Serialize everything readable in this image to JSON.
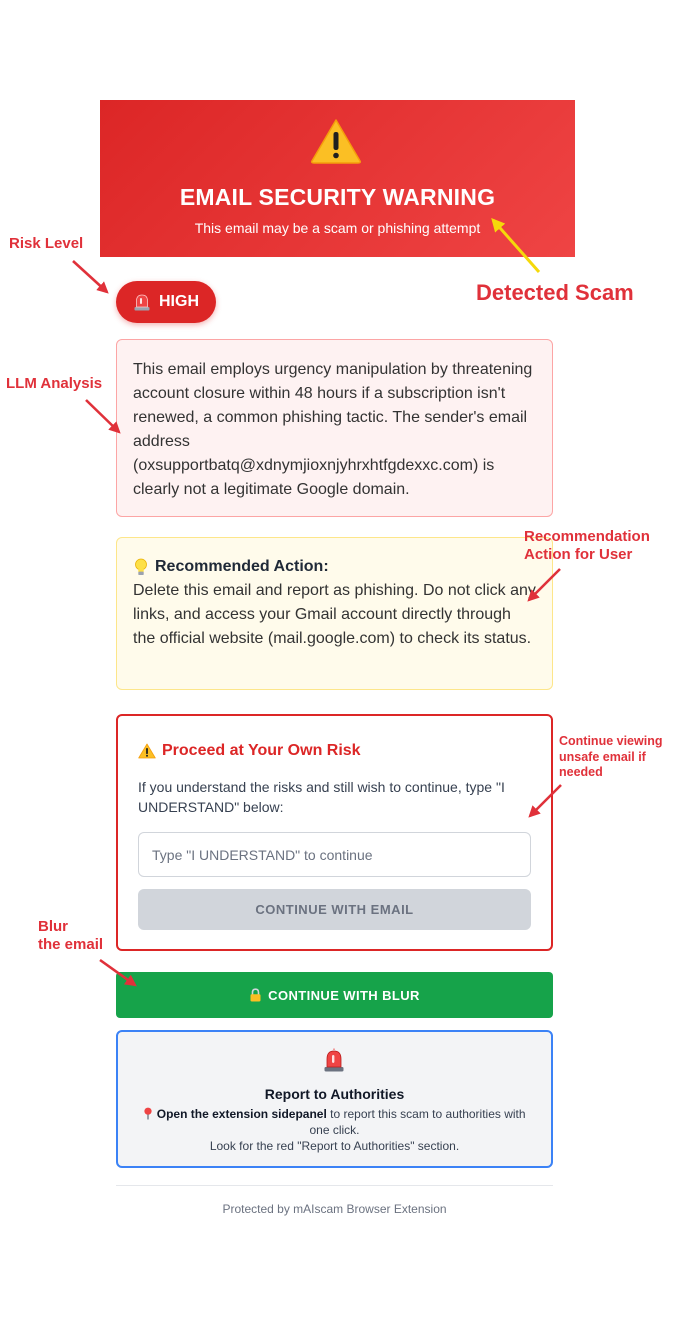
{
  "banner": {
    "title": "EMAIL SECURITY WARNING",
    "subtitle": "This email may be a scam or phishing attempt",
    "icon": "warning-triangle-icon"
  },
  "risk": {
    "label": "HIGH",
    "icon": "siren-icon"
  },
  "analysis": {
    "text": "This email employs urgency manipulation by threatening account closure within 48 hours if a subscription isn't renewed, a common phishing tactic. The sender's email address (oxsupportbatq@xdnymjioxnjyhrxhtfgdexxc.com) is clearly not a legitimate Google domain."
  },
  "recommendation": {
    "heading": "Recommended Action:",
    "icon": "lightbulb-icon",
    "text": "Delete this email and report as phishing. Do not click any links, and access your Gmail account directly through the official website (mail.google.com) to check its status."
  },
  "proceed": {
    "title": "Proceed at Your Own Risk",
    "text": "If you understand the risks and still wish to continue, type \"I UNDERSTAND\" below:",
    "input_placeholder": "Type \"I UNDERSTAND\" to continue",
    "input_value": "",
    "button_label": "CONTINUE WITH EMAIL"
  },
  "blur_button": {
    "label": "CONTINUE WITH BLUR",
    "icon": "lock-icon"
  },
  "report": {
    "title": "Report to Authorities",
    "link_text": "Open the extension sidepanel",
    "text_rest": " to report this scam to authorities with one click.",
    "line2": "Look for the red \"Report to Authorities\" section."
  },
  "footer": {
    "text": "Protected by mAIscam Browser Extension"
  },
  "annotations": {
    "risk_level": "Risk Level",
    "llm_analysis": "LLM Analysis",
    "detected_scam": "Detected Scam",
    "recommendation_line1": "Recommendation",
    "recommendation_line2": "Action for User",
    "continue_line1": "Continue viewing",
    "continue_line2": "unsafe email if",
    "continue_line3": "needed",
    "blur_line1": "Blur",
    "blur_line2": "the email"
  },
  "colors": {
    "danger": "#dc2626",
    "success": "#16a34a",
    "info_border": "#3b82f6",
    "annotation": "#e0313a",
    "annotation_arrow_yellow": "#f5d90a"
  }
}
